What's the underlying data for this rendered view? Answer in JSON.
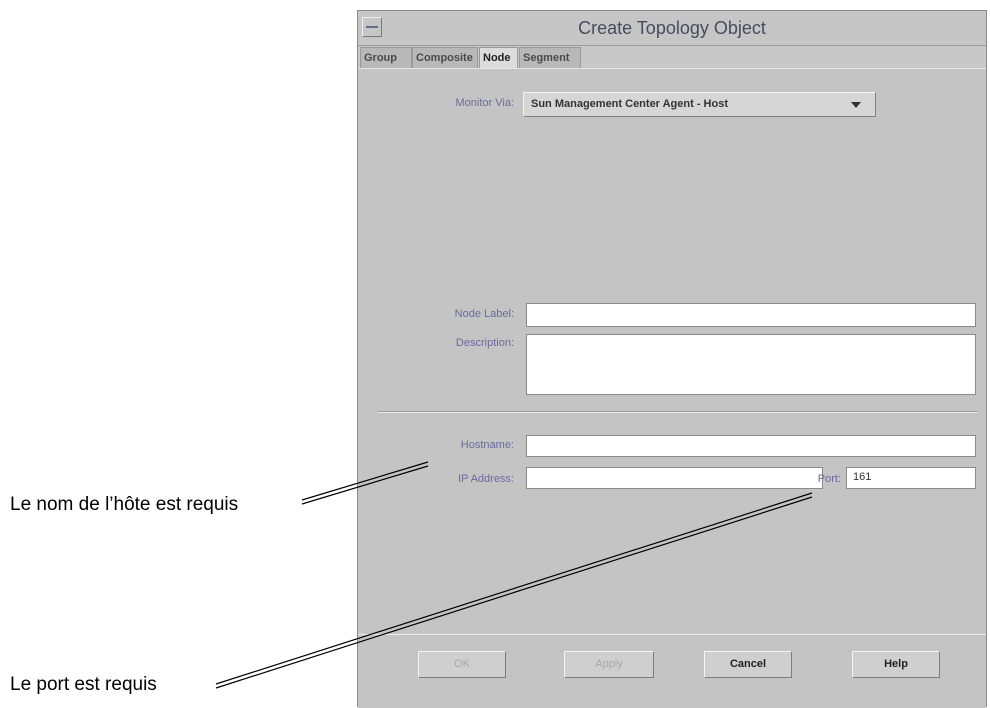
{
  "window": {
    "title": "Create Topology Object"
  },
  "tabs": [
    {
      "label": "Group",
      "active": false
    },
    {
      "label": "Composite",
      "active": false
    },
    {
      "label": "Node",
      "active": true
    },
    {
      "label": "Segment",
      "active": false
    }
  ],
  "form": {
    "monitor_via_label": "Monitor Via:",
    "monitor_via_value": "Sun Management Center Agent - Host",
    "node_label_label": "Node Label:",
    "node_label_value": "",
    "description_label": "Description:",
    "description_value": "",
    "hostname_label": "Hostname:",
    "hostname_value": "",
    "ip_address_label": "IP Address:",
    "ip_address_value": "",
    "port_label": "Port:",
    "port_value": "161"
  },
  "buttons": {
    "ok": "OK",
    "apply": "Apply",
    "cancel": "Cancel",
    "help": "Help"
  },
  "annotations": {
    "hostname_required": "Le nom de l’hôte est requis",
    "port_required": "Le port est requis"
  }
}
